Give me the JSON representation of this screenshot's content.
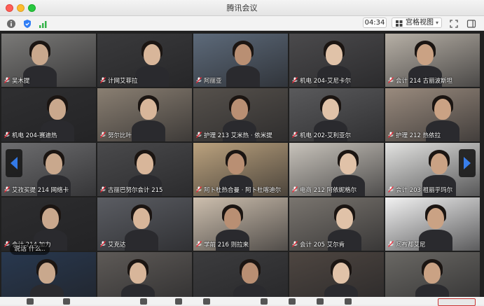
{
  "window": {
    "title": "腾讯会议"
  },
  "toolbar": {
    "info_icon": "info-icon",
    "shield_icon": "shield-icon",
    "signal_icon": "signal-icon",
    "timer": "04:34",
    "view_label": "宫格视图",
    "fullscreen_icon": "fullscreen-icon",
    "sidebar_icon": "sidebar-toggle-icon"
  },
  "speaker_hint": "说话 什么..",
  "participants": [
    {
      "name": "吴木提"
    },
    {
      "name": "计网艾菲拉"
    },
    {
      "name": "阿丽亚"
    },
    {
      "name": "机电 204-艾尼卡尔"
    },
    {
      "name": "会计 214 古丽波斯坦"
    },
    {
      "name": "机电 204-赛迪热"
    },
    {
      "name": "努尔比叶"
    },
    {
      "name": "护理 213 艾米热 · 依米提"
    },
    {
      "name": "机电 202-艾利亚尔"
    },
    {
      "name": "护理 212 热依拉"
    },
    {
      "name": "艾孜买提 214 网络卡"
    },
    {
      "name": "古丽巴努尔会计 215"
    },
    {
      "name": "阿卜杜热合曼 · 阿卜杜喀迪尔"
    },
    {
      "name": "电商 212 阿依妮格尔"
    },
    {
      "name": "会计 203 祖丽乎玛尔"
    },
    {
      "name": "会计 214 加力"
    },
    {
      "name": "艾克达"
    },
    {
      "name": "学前 216 则拉来"
    },
    {
      "name": "会计 205 艾尔肯"
    },
    {
      "name": "阿布都艾尼"
    },
    {
      "name": ""
    },
    {
      "name": ""
    },
    {
      "name": ""
    },
    {
      "name": ""
    },
    {
      "name": ""
    }
  ],
  "colors": {
    "stage": "#202020",
    "accent_arrow": "#2f7df6"
  }
}
